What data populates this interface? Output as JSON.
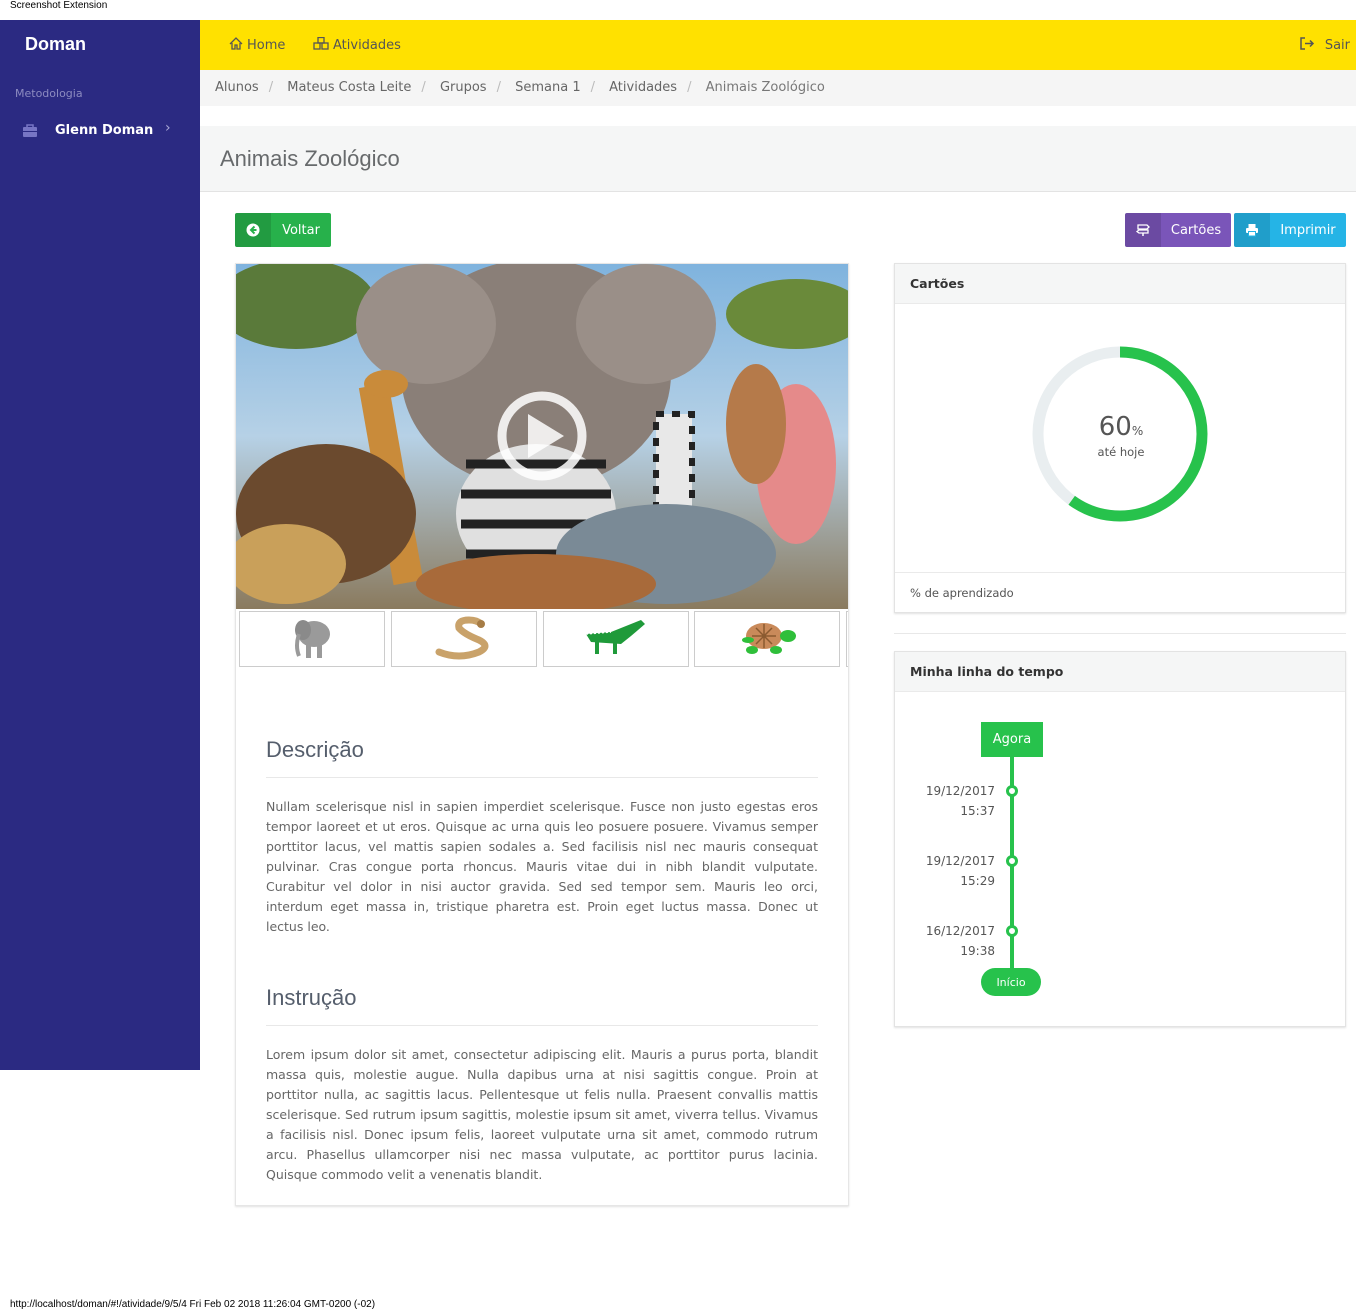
{
  "extension_label": "Screenshot Extension",
  "sidebar": {
    "brand": "Doman",
    "section": "Metodologia",
    "item_label": "Glenn Doman"
  },
  "topbar": {
    "home_label": "Home",
    "atividades_label": "Atividades",
    "sair_label": "Sair"
  },
  "breadcrumb": {
    "items": [
      "Alunos",
      "Mateus Costa Leite",
      "Grupos",
      "Semana 1",
      "Atividades"
    ],
    "active": "Animais Zoológico"
  },
  "page": {
    "title": "Animais Zoológico"
  },
  "buttons": {
    "voltar": "Voltar",
    "cartoes": "Cartões",
    "imprimir": "Imprimir"
  },
  "media": {
    "thumbnails": [
      "elephant-icon",
      "snake-icon",
      "crocodile-icon",
      "turtle-icon"
    ]
  },
  "descricao": {
    "title": "Descrição",
    "text": "Nullam scelerisque nisl in sapien imperdiet scelerisque. Fusce non justo egestas eros tempor laoreet et ut eros. Quisque ac urna quis leo posuere posuere. Vivamus semper porttitor lacus, vel mattis sapien sodales a. Sed facilisis nisl nec mauris consequat pulvinar. Cras congue porta rhoncus. Mauris vitae dui in nibh blandit vulputate. Curabitur vel dolor in nisi auctor gravida. Sed sed tempor sem. Mauris leo orci, interdum eget massa in, tristique pharetra est. Proin eget luctus massa. Donec ut lectus leo."
  },
  "instrucao": {
    "title": "Instrução",
    "text": "Lorem ipsum dolor sit amet, consectetur adipiscing elit. Mauris a purus porta, blandit massa quis, molestie augue. Nulla dapibus urna at nisi sagittis congue. Proin at porttitor nulla, ac sagittis lacus. Pellentesque ut felis nulla. Praesent convallis mattis scelerisque. Sed rutrum ipsum sagittis, molestie ipsum sit amet, viverra tellus. Vivamus a facilisis nisl. Donec ipsum felis, laoreet vulputate urna sit amet, commodo rutrum arcu. Phasellus ullamcorper nisi nec massa vulputate, ac porttitor purus lacinia. Quisque commodo velit a venenatis blandit."
  },
  "cartoes_panel": {
    "title": "Cartões",
    "percent": 60,
    "percent_text": "60",
    "percent_sign": "%",
    "subtitle": "até hoje",
    "footer": "% de aprendizado"
  },
  "timeline": {
    "title": "Minha linha do tempo",
    "top_label": "Agora",
    "bottom_label": "Início",
    "events": [
      {
        "date": "19/12/2017",
        "time": "15:37"
      },
      {
        "date": "19/12/2017",
        "time": "15:29"
      },
      {
        "date": "16/12/2017",
        "time": "19:38"
      }
    ]
  },
  "colors": {
    "sidebar": "#2b2a82",
    "topbar": "#ffe100",
    "success": "#27c24c",
    "purple": "#7a55b9",
    "info": "#25b4e6"
  },
  "footer_url": "http://localhost/doman/#!/atividade/9/5/4 Fri Feb 02 2018 11:26:04 GMT-0200 (-02)"
}
